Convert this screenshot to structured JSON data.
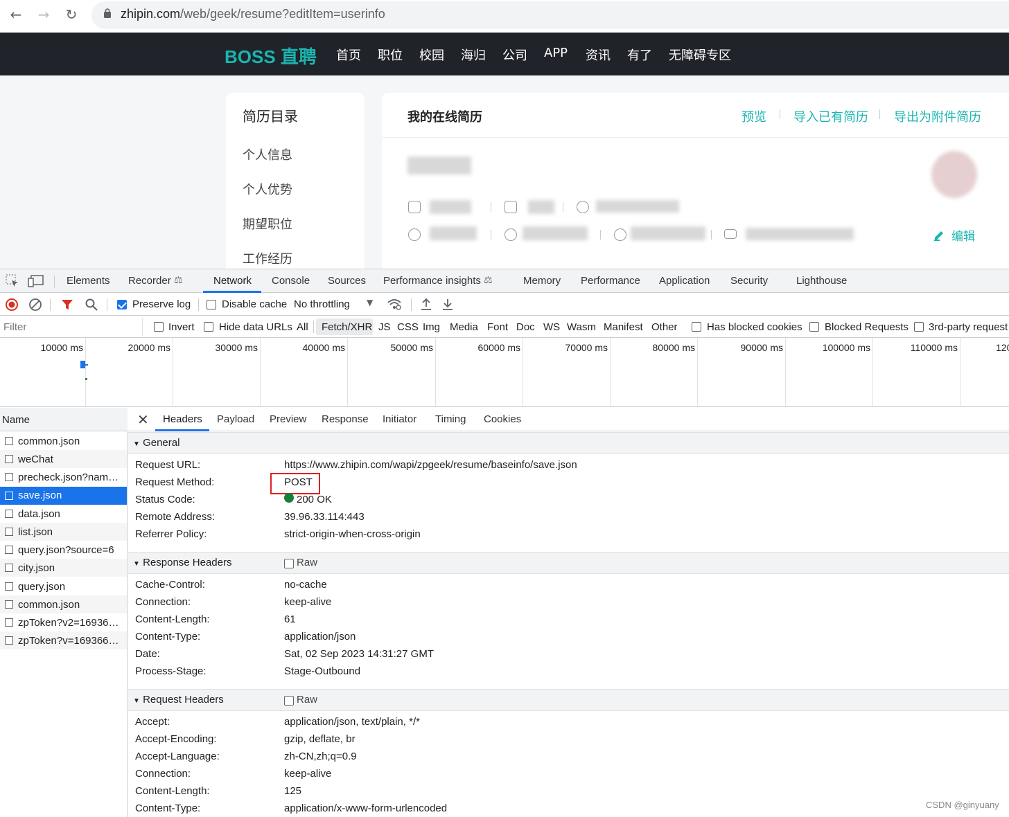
{
  "browser": {
    "url_host": "zhipin.com",
    "url_path": "/web/geek/resume?editItem=userinfo"
  },
  "site": {
    "logo": "BOSS 直聘",
    "nav": [
      "首页",
      "职位",
      "校园",
      "海归",
      "公司",
      "APP",
      "资讯",
      "有了",
      "无障碍专区"
    ]
  },
  "resume": {
    "sidebar_title": "简历目录",
    "sidebar_items": [
      "个人信息",
      "个人优势",
      "期望职位",
      "工作经历"
    ],
    "title": "我的在线简历",
    "links": [
      "预览",
      "导入已有简历",
      "导出为附件简历"
    ],
    "edit_label": "编辑"
  },
  "devtools": {
    "tabs": [
      "Elements",
      "Recorder",
      "Network",
      "Console",
      "Sources",
      "Performance insights",
      "Memory",
      "Performance",
      "Application",
      "Security",
      "Lighthouse"
    ],
    "active_tab": "Network",
    "toolbar": {
      "preserve_log": "Preserve log",
      "disable_cache": "Disable cache",
      "throttling": "No throttling"
    },
    "filter": {
      "placeholder": "Filter",
      "invert": "Invert",
      "hide_data_urls": "Hide data URLs",
      "types": [
        "All",
        "Fetch/XHR",
        "JS",
        "CSS",
        "Img",
        "Media",
        "Font",
        "Doc",
        "WS",
        "Wasm",
        "Manifest",
        "Other"
      ],
      "active_type": "Fetch/XHR",
      "has_blocked_cookies": "Has blocked cookies",
      "blocked_requests": "Blocked Requests",
      "third_party": "3rd-party request"
    },
    "timeline_ticks": [
      "10000 ms",
      "20000 ms",
      "30000 ms",
      "40000 ms",
      "50000 ms",
      "60000 ms",
      "70000 ms",
      "80000 ms",
      "90000 ms",
      "100000 ms",
      "110000 ms",
      "120"
    ],
    "name_header": "Name",
    "requests": [
      "common.json",
      "weChat",
      "precheck.json?name...",
      "save.json",
      "data.json",
      "list.json",
      "query.json?source=6",
      "city.json",
      "query.json",
      "common.json",
      "zpToken?v2=169366...",
      "zpToken?v=1693665..."
    ],
    "selected_request": "save.json",
    "detail_tabs": [
      "Headers",
      "Payload",
      "Preview",
      "Response",
      "Initiator",
      "Timing",
      "Cookies"
    ],
    "general": {
      "title": "General",
      "rows": [
        {
          "k": "Request URL:",
          "v": "https://www.zhipin.com/wapi/zpgeek/resume/baseinfo/save.json"
        },
        {
          "k": "Request Method:",
          "v": "POST"
        },
        {
          "k": "Status Code:",
          "v": "200 OK"
        },
        {
          "k": "Remote Address:",
          "v": "39.96.33.114:443"
        },
        {
          "k": "Referrer Policy:",
          "v": "strict-origin-when-cross-origin"
        }
      ]
    },
    "response_headers": {
      "title": "Response Headers",
      "raw": "Raw",
      "rows": [
        {
          "k": "Cache-Control:",
          "v": "no-cache"
        },
        {
          "k": "Connection:",
          "v": "keep-alive"
        },
        {
          "k": "Content-Length:",
          "v": "61"
        },
        {
          "k": "Content-Type:",
          "v": "application/json"
        },
        {
          "k": "Date:",
          "v": "Sat, 02 Sep 2023 14:31:27 GMT"
        },
        {
          "k": "Process-Stage:",
          "v": "Stage-Outbound"
        }
      ]
    },
    "request_headers": {
      "title": "Request Headers",
      "raw": "Raw",
      "rows": [
        {
          "k": "Accept:",
          "v": "application/json, text/plain, */*"
        },
        {
          "k": "Accept-Encoding:",
          "v": "gzip, deflate, br"
        },
        {
          "k": "Accept-Language:",
          "v": "zh-CN,zh;q=0.9"
        },
        {
          "k": "Connection:",
          "v": "keep-alive"
        },
        {
          "k": "Content-Length:",
          "v": "125"
        },
        {
          "k": "Content-Type:",
          "v": "application/x-www-form-urlencoded"
        }
      ]
    }
  },
  "watermark": "CSDN @ginyuany",
  "colors": {
    "brand": "#19b5b0",
    "accent": "#1a73e8",
    "highlight": "#e02020",
    "status_ok": "#188038"
  }
}
